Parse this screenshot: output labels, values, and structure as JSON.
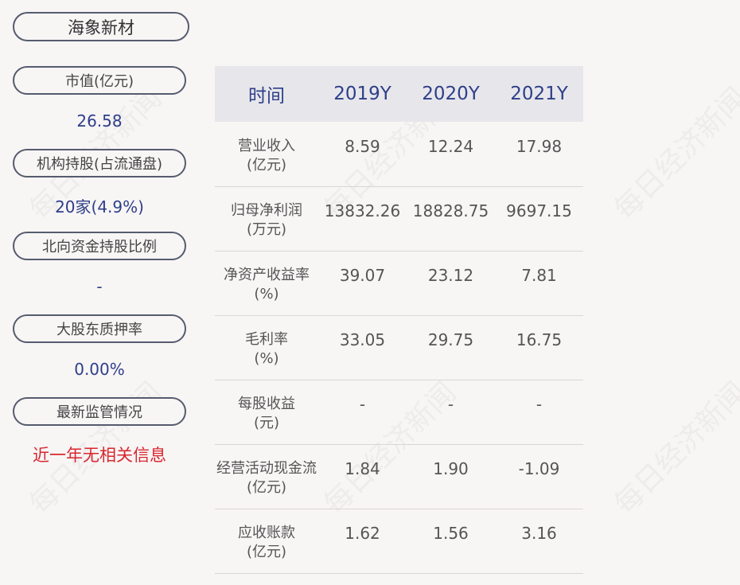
{
  "company": "海象新材",
  "watermark": "每日经济新闻",
  "left_panel": [
    {
      "label": "市值(亿元)",
      "value": "26.58"
    },
    {
      "label": "机构持股(占流通盘)",
      "value": "20家(4.9%)"
    },
    {
      "label": "北向资金持股比例",
      "value": "-"
    },
    {
      "label": "大股东质押率",
      "value": "0.00%"
    },
    {
      "label": "最新监管情况",
      "value": "近一年无相关信息"
    }
  ],
  "colors": {
    "accent": "#2e3f8a",
    "alert": "#d8272f"
  },
  "table": {
    "headers": [
      "时间",
      "2019Y",
      "2020Y",
      "2021Y"
    ],
    "rows": [
      {
        "label1": "营业收入",
        "label2": "(亿元)",
        "values": [
          "8.59",
          "12.24",
          "17.98"
        ]
      },
      {
        "label1": "归母净利润",
        "label2": "(万元)",
        "values": [
          "13832.26",
          "18828.75",
          "9697.15"
        ]
      },
      {
        "label1": "净资产收益率",
        "label2": "(%)",
        "values": [
          "39.07",
          "23.12",
          "7.81"
        ]
      },
      {
        "label1": "毛利率",
        "label2": "(%)",
        "values": [
          "33.05",
          "29.75",
          "16.75"
        ]
      },
      {
        "label1": "每股收益",
        "label2": "(元)",
        "values": [
          "-",
          "-",
          "-"
        ]
      },
      {
        "label1": "经营活动现金流",
        "label2": "(亿元)",
        "values": [
          "1.84",
          "1.90",
          "-1.09"
        ]
      },
      {
        "label1": "应收账款",
        "label2": "(亿元)",
        "values": [
          "1.62",
          "1.56",
          "3.16"
        ]
      }
    ]
  }
}
